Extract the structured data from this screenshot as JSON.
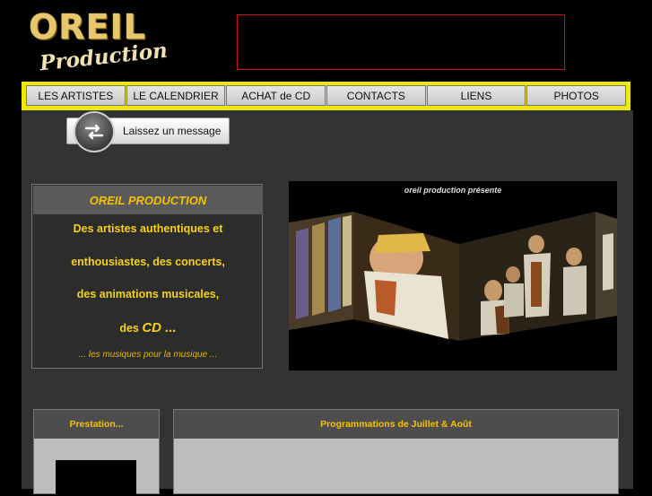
{
  "logo": {
    "main": "OREIL",
    "sub": "Production"
  },
  "nav": [
    "LES ARTISTES",
    "LE CALENDRIER",
    "ACHAT de CD",
    "CONTACTS",
    "LIENS",
    "PHOTOS"
  ],
  "message_button": {
    "label": "Laissez un message",
    "icon": "exchange-arrows-icon"
  },
  "intro": {
    "title": "OREIL PRODUCTION",
    "line1": "Des artistes authentiques et",
    "line2": "enthousiastes, des concerts,",
    "line3": "des animations musicales,",
    "line4_prefix": "des",
    "line4_em": "CD ...",
    "tagline": "... les musiques pour la musique ..."
  },
  "slideshow": {
    "title": "oreil production présente"
  },
  "prestation": {
    "title": "Prestation..."
  },
  "programmation": {
    "title": "Programmations de Juillet & Août"
  },
  "colors": {
    "accent": "#f0e800",
    "gold_text": "#f6c200",
    "panel": "#333333",
    "banner_border": "#d01010"
  }
}
